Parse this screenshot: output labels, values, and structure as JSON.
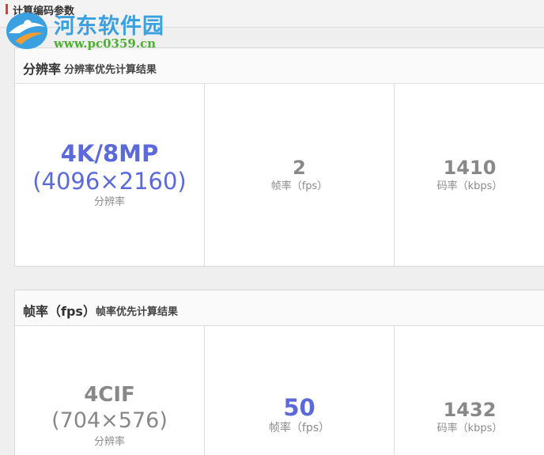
{
  "section": {
    "title": "计算编码参数"
  },
  "watermark": {
    "name": "河东软件园",
    "url": "www.pc0359.cn"
  },
  "panels": [
    {
      "title": "分辨率",
      "subtitle": "分辨率优先计算结果",
      "cells": [
        {
          "value": "4K/8MP",
          "detail": "(4096×2160)",
          "label": "分辨率"
        },
        {
          "value": "2",
          "label": "帧率（fps）"
        },
        {
          "value": "1410",
          "label": "码率（kbps）"
        }
      ]
    },
    {
      "title": "帧率（fps）",
      "subtitle": "帧率优先计算结果",
      "cells": [
        {
          "value": "4CIF",
          "detail": "(704×576)",
          "label": "分辨率"
        },
        {
          "value": "50",
          "label": "帧率（fps）"
        },
        {
          "value": "1432",
          "label": "码率（kbps）"
        }
      ]
    }
  ],
  "colors": {
    "highlight": "#5b6ad8",
    "normal": "#888888",
    "accent": "#e23b3b"
  }
}
